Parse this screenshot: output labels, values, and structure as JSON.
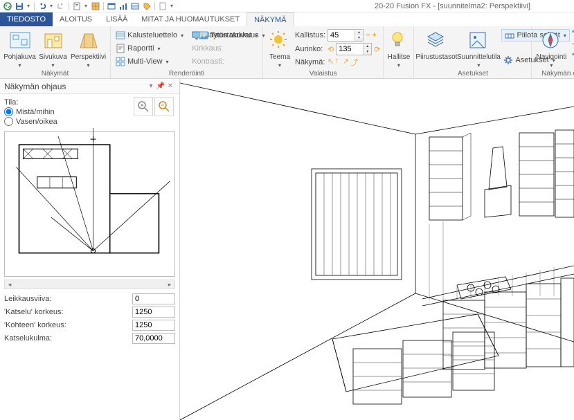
{
  "app": {
    "title": "20-20 Fusion FX - [suunnitelma2: Perspektiivi]"
  },
  "tabs": {
    "file": "TIEDOSTO",
    "items": [
      "ALOITUS",
      "LISÄÄ",
      "MITAT JA HUOMAUTUKSET",
      "NÄKYMÄ"
    ],
    "active": "NÄKYMÄ"
  },
  "ribbon": {
    "groups": {
      "nakymat": {
        "label": "Näkymät",
        "pohjakuva": "Pohjakuva",
        "sivukuva": "Sivukuva",
        "perspektiivi": "Perspektiivi"
      },
      "renderointi": {
        "label": "Renderöinti",
        "kalusteluettelo": "Kalusteluettelo",
        "raportti": "Raportti",
        "multiview": "Multi-View",
        "nayton_tarkkuus": "Näytön tarkkuus",
        "kirkkaus": "Kirkkaus:",
        "kontrasti": "Kontrasti:",
        "taustakuvat": "Taustakuvat"
      },
      "valaistus": {
        "label": "Valaistus",
        "teema": "Teema",
        "nakyma": "Näkymä:",
        "kallistus": "Kallistus:",
        "kallistus_val": "45",
        "aurinko": "Aurinko:",
        "aurinko_val": "135"
      },
      "hallitse": {
        "label": "",
        "btn": "Hallitse"
      },
      "asetukset": {
        "label": "Asetukset",
        "piirustustasot": "Piirustustasot",
        "suunnittelutila": "Suunnittelutila",
        "piilota": "Piilota seinät",
        "asetukset": "Asetukset"
      },
      "navigointi": {
        "label": "Näkymän ohjaus",
        "btn": "Navigointi"
      }
    }
  },
  "sidepanel": {
    "title": "Näkymän ohjaus",
    "tila": "Tila:",
    "r1": "Mistä/mihin",
    "r2": "Vasen/oikea",
    "fields": {
      "leikkausviiva": {
        "label": "Leikkausviiva:",
        "value": "0"
      },
      "katselu": {
        "label": "'Katselu' korkeus:",
        "value": "1250"
      },
      "kohteen": {
        "label": "'Kohteen' korkeus:",
        "value": "1250"
      },
      "katselukulma": {
        "label": "Katselukulma:",
        "value": "70,0000"
      }
    }
  }
}
